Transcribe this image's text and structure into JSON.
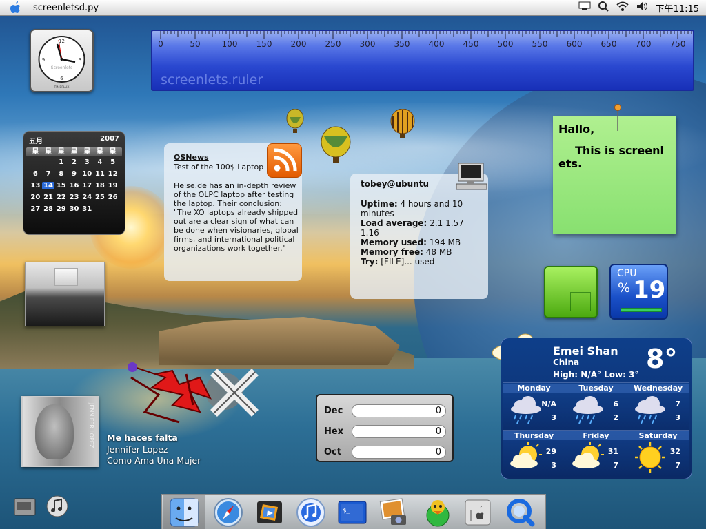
{
  "menubar": {
    "app_name": "screenletsd.py",
    "time": "下午11:15"
  },
  "ruler": {
    "ticks": [
      "0",
      "50",
      "100",
      "150",
      "200",
      "250",
      "300",
      "350",
      "400",
      "450",
      "500",
      "550",
      "600",
      "650",
      "700",
      "750"
    ],
    "label": "screenlets.ruler"
  },
  "clock": {
    "label": "Screenlets",
    "brand": "TIMEFLUX"
  },
  "calendar": {
    "month": "五月",
    "year": "2007",
    "weekdays": [
      "星",
      "星",
      "星",
      "星",
      "星",
      "星",
      "星"
    ],
    "days": [
      "",
      "",
      "1",
      "2",
      "3",
      "4",
      "5",
      "6",
      "7",
      "8",
      "9",
      "10",
      "11",
      "12",
      "13",
      "14",
      "15",
      "16",
      "17",
      "18",
      "19",
      "20",
      "21",
      "22",
      "23",
      "24",
      "25",
      "26",
      "27",
      "28",
      "29",
      "30",
      "31",
      "",
      ""
    ],
    "today": "14"
  },
  "news": {
    "source": "OSNews",
    "headline": "Test of the 100$ Laptop",
    "body": "Heise.de has an in-depth review of the OLPC laptop after testing the laptop. Their conclusion: \"The XO laptops already shipped out are a clear sign of what can be done when visionaries, global firms, and international political organizations work together.\""
  },
  "sysinfo": {
    "host": "tobey@ubuntu",
    "uptime_label": "Uptime:",
    "uptime": "4 hours and 10 minutes",
    "load_label": "Load average:",
    "load": "2.1 1.57 1.16",
    "memused_label": "Memory used:",
    "memused": "194 MB",
    "memfree_label": "Memory free:",
    "memfree": "48 MB",
    "try_label": "Try:",
    "try": "[FILE]... used"
  },
  "note": {
    "line1": "Hallo,",
    "line2": "This is screenl",
    "line3": "ets."
  },
  "cpu": {
    "label": "CPU",
    "percent_sign": "%",
    "value": "19",
    "usage": 0.19
  },
  "weather": {
    "city": "Emei Shan",
    "country": "China",
    "high_low": "High: N/A°  Low: 3°",
    "temp": "8°",
    "days": [
      {
        "name": "Monday",
        "hi": "N/A",
        "lo": "3",
        "icon": "rain-cloud-icon"
      },
      {
        "name": "Tuesday",
        "hi": "6",
        "lo": "2",
        "icon": "rain-cloud-icon"
      },
      {
        "name": "Wednesday",
        "hi": "7",
        "lo": "3",
        "icon": "rain-cloud-icon"
      },
      {
        "name": "Thursday",
        "hi": "29",
        "lo": "3",
        "icon": "sun-cloud-icon"
      },
      {
        "name": "Friday",
        "hi": "31",
        "lo": "7",
        "icon": "sun-cloud-icon"
      },
      {
        "name": "Saturday",
        "hi": "32",
        "lo": "7",
        "icon": "sun-icon"
      }
    ]
  },
  "converter": {
    "rows": [
      {
        "label": "Dec",
        "value": "0"
      },
      {
        "label": "Hex",
        "value": "0"
      },
      {
        "label": "Oct",
        "value": "0"
      }
    ]
  },
  "music": {
    "cover_text": "JENNIFER LOPEZ",
    "song": "Me haces falta",
    "artist": "Jennifer Lopez",
    "album": "Como Ama Una Mujer"
  },
  "dock": {
    "items": [
      "finder-icon",
      "safari-icon",
      "imovie-icon",
      "itunes-icon",
      "terminal-icon",
      "iphoto-icon",
      "adium-icon",
      "system-prefs-icon",
      "quicktime-icon"
    ]
  },
  "colors": {
    "ruler": "#2a48d0",
    "note": "#a0ea80",
    "weather_panel": "#0e3f8a",
    "cpu_panel": "#1a50c8"
  }
}
